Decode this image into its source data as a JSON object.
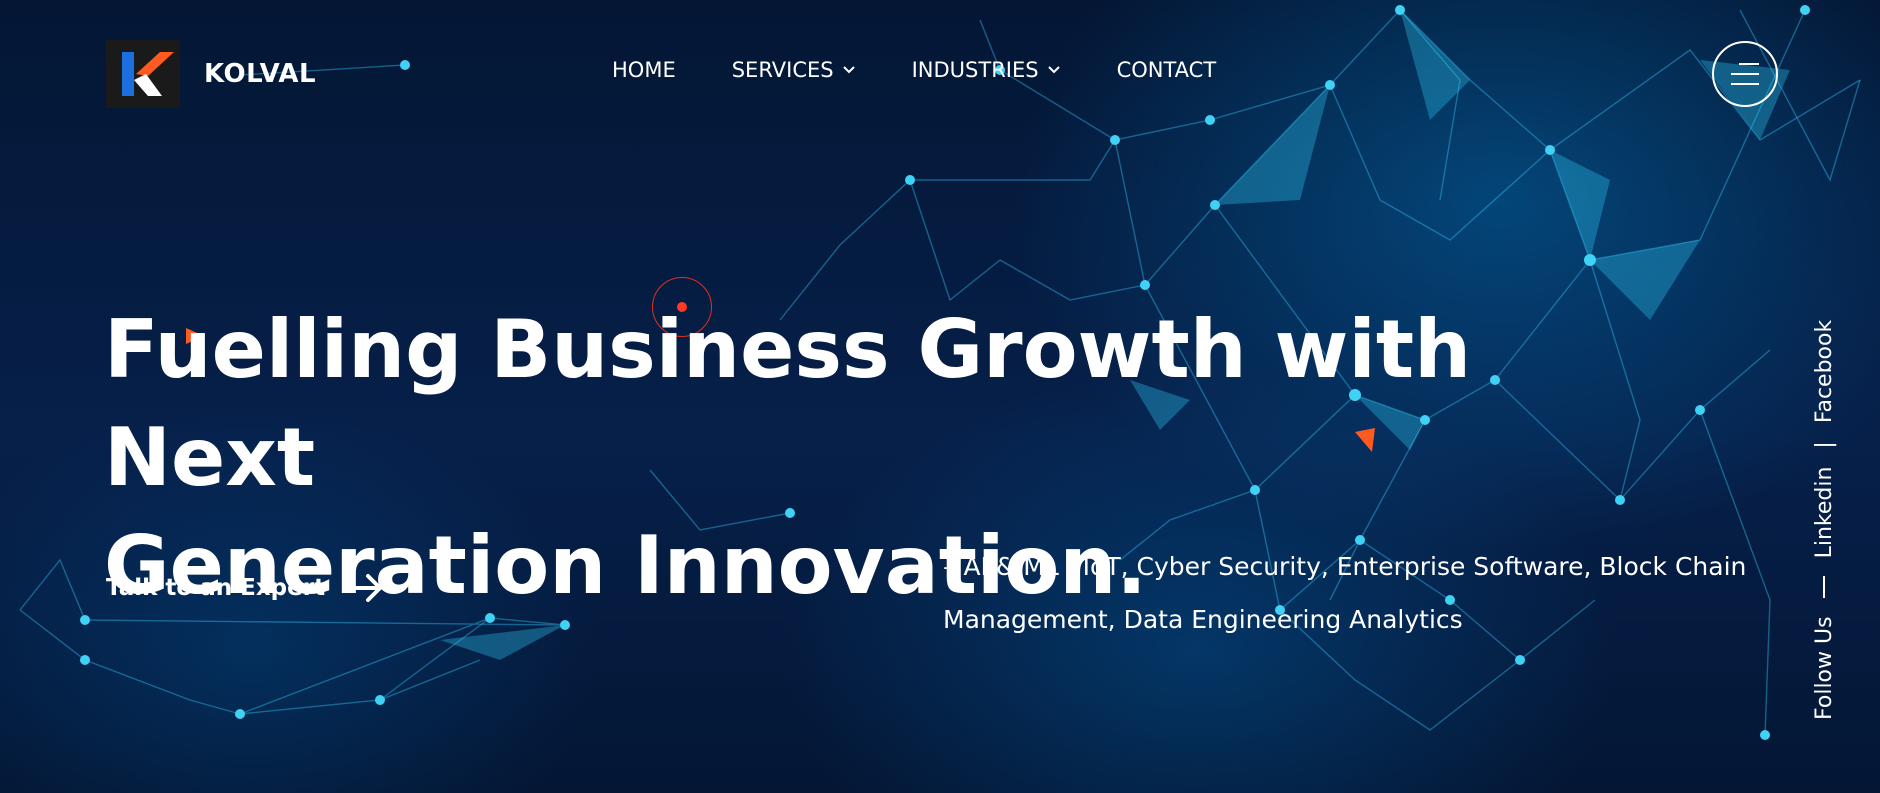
{
  "brand": {
    "name": "KOLVAL"
  },
  "nav": {
    "items": [
      {
        "label": "HOME",
        "has_dropdown": false
      },
      {
        "label": "SERVICES",
        "has_dropdown": true
      },
      {
        "label": "INDUSTRIES",
        "has_dropdown": true
      },
      {
        "label": "CONTACT",
        "has_dropdown": false
      }
    ]
  },
  "menu_button": {
    "icon": "hamburger-icon"
  },
  "hero": {
    "headline_line1": "Fuelling Business Growth with Next",
    "headline_line2": "Generation Innovation.",
    "cta_label": "Talk to an Expert",
    "cta_icon": "arrow-right-icon",
    "tagline_line1": "– AI & ML , IoT, Cyber Security, Enterprise Software, Block Chain",
    "tagline_line2": "Management, Data Engineering Analytics"
  },
  "social": {
    "label": "Follow Us",
    "links": [
      "Linkedin",
      "Facebook"
    ],
    "separator": "|"
  },
  "colors": {
    "background": "#04142f",
    "accent_orange": "#ff5a1f",
    "logo_blue": "#1d6fe0",
    "network_cyan": "#2fc6f0",
    "text": "#ffffff"
  }
}
